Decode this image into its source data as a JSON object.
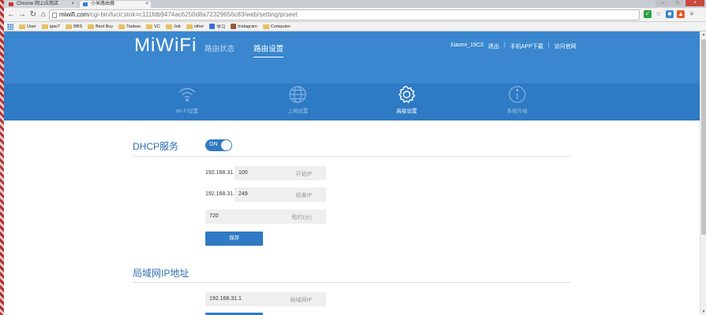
{
  "browser": {
    "tabs": [
      {
        "label": "Chrome 网上应用店"
      },
      {
        "label": "小米路由器"
      }
    ],
    "window_controls": {
      "minimize": "–",
      "maximize": "□",
      "close": "×"
    },
    "nav": {
      "back": "←",
      "forward": "→",
      "reload": "↻",
      "home": "⌂"
    },
    "url": {
      "host": "miwifi.com",
      "path": "/cgi-bin/luci/;stok=c111fdb9474ac6250d8a72329656c83/web/setting/prseet"
    },
    "bookmarks": [
      "User",
      "igao7",
      "BBS",
      "Best Buy",
      "Taobao",
      "VC",
      "Job",
      "other",
      "学习",
      "Instagram",
      "Computex"
    ]
  },
  "header": {
    "logo": "MiWiFi",
    "nav": [
      {
        "label": "路由状态"
      },
      {
        "label": "路由设置"
      }
    ],
    "user": {
      "name": "Xiaomi_19C3",
      "logout": "退出",
      "app": "手机APP下载",
      "site": "访问官网",
      "sep": "|"
    }
  },
  "subnav": [
    {
      "label": "Wi-Fi设置",
      "icon": "wifi-icon"
    },
    {
      "label": "上网设置",
      "icon": "globe-icon"
    },
    {
      "label": "高级设置",
      "icon": "gear-icon"
    },
    {
      "label": "系统升级",
      "icon": "info-icon"
    }
  ],
  "dhcp": {
    "title": "DHCP服务",
    "toggle": "ON",
    "ip_prefix": "192.168.31.",
    "start_value": "100",
    "start_placeholder": "开始IP",
    "end_value": "249",
    "end_placeholder": "结束IP",
    "lease_value": "720",
    "lease_placeholder": "租约(分)",
    "save": "保存"
  },
  "lan": {
    "title": "局域网IP地址",
    "ip_value": "192.168.31.1",
    "ip_placeholder": "局域网IP"
  },
  "colors": {
    "brand": "#3a87cf",
    "accent": "#2f7ac4"
  }
}
